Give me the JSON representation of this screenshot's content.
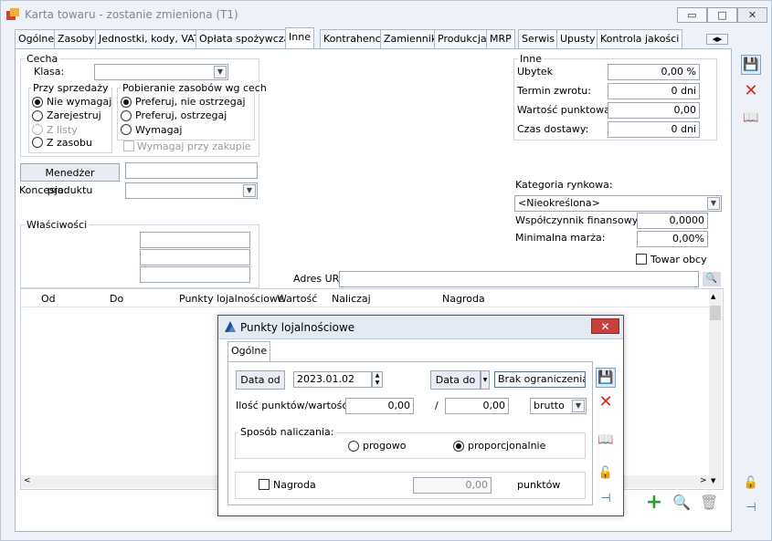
{
  "window": {
    "title": "Karta towaru - zostanie zmieniona (T1)",
    "min_label": "▭",
    "max_label": "□",
    "close_label": "✕"
  },
  "tabs": [
    {
      "label": "Ogólne"
    },
    {
      "label": "Zasoby"
    },
    {
      "label": "Jednostki, kody, VAT"
    },
    {
      "label": "Opłata spożywcza"
    },
    {
      "label": "Inne"
    },
    {
      "label": "Kontrahenci"
    },
    {
      "label": "Zamienniki"
    },
    {
      "label": "Produkcja"
    },
    {
      "label": "MRP"
    },
    {
      "label": "Serwis"
    },
    {
      "label": "Upusty"
    },
    {
      "label": "Kontrola jakości"
    }
  ],
  "cecha": {
    "group": "Cecha",
    "klasa_label": "Klasa:",
    "klasa_value": "",
    "przy_sprzedazy": "Przy sprzedaży",
    "opts": [
      "Nie wymagaj",
      "Zarejestruj",
      "Z listy",
      "Z zasobu"
    ],
    "pobieranie": "Pobieranie zasobów wg cech",
    "pob_opts": [
      "Preferuj, nie ostrzegaj",
      "Preferuj, ostrzegaj",
      "Wymagaj"
    ],
    "wymagaj_zakupie": "Wymagaj przy zakupie"
  },
  "menedzer_label": "Menedżer produktu",
  "menedzer_value": "",
  "koncesja_label": "Koncesja:",
  "koncesja_value": "",
  "wlasciwosci": "Właściwości",
  "inne": {
    "group": "Inne",
    "ubytek_label": "Ubytek",
    "ubytek_value": "0,00 %",
    "termin_label": "Termin zwrotu:",
    "termin_value": "0 dni",
    "wartosc_label": "Wartość punktowa:",
    "wartosc_value": "0,00",
    "czas_label": "Czas dostawy:",
    "czas_value": "0 dni"
  },
  "kategoria_label": "Kategoria rynkowa:",
  "kategoria_value": "<Nieokreślona>",
  "wspolczynnik_label": "Współczynnik finansowy:",
  "wspolczynnik_value": "0,0000",
  "marza_label": "Minimalna marża:",
  "marza_value": "0,00%",
  "towar_obcy": "Towar obcy",
  "adres_label": "Adres URL:",
  "adres_value": "",
  "table_columns": [
    "Od",
    "Do",
    "Punkty lojalnościowe",
    "Wartość",
    "Naliczaj",
    "Nagroda"
  ],
  "dialog": {
    "title": "Punkty lojalnościowe",
    "close": "✕",
    "tab": "Ogólne",
    "data_od_btn": "Data od",
    "data_od_value": "2023.01.02",
    "data_do_btn": "Data do",
    "data_do_value": "Brak ograniczenia",
    "ilosc_label": "Ilość punktów/wartość:",
    "ilosc_value1": "0,00",
    "slash": "/",
    "ilosc_value2": "0,00",
    "brutto": "brutto",
    "sposob_label": "Sposób naliczania:",
    "progowo": "progowo",
    "proporcjonalnie": "proporcjonalnie",
    "nagroda_label": "Nagroda",
    "nagroda_value": "0,00",
    "punktow": "punktów"
  }
}
